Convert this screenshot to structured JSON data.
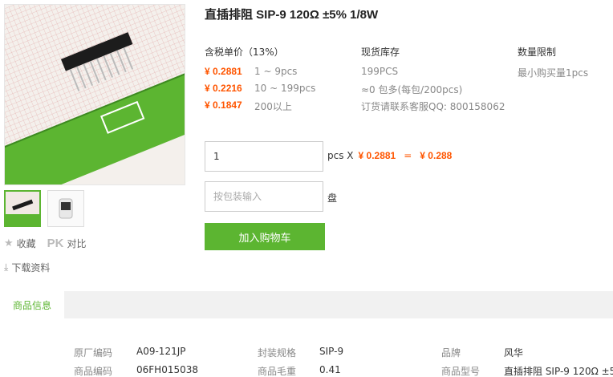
{
  "product": {
    "title": "直插排阻 SIP-9 120Ω ±5% 1/8W"
  },
  "pricing": {
    "header": "含税单价（13%）",
    "tiers": [
      {
        "price": "¥ 0.2881",
        "qty": "1 ~ 9pcs"
      },
      {
        "price": "¥ 0.2216",
        "qty": "10 ~ 199pcs"
      },
      {
        "price": "¥ 0.1847",
        "qty": "200以上"
      }
    ]
  },
  "stock": {
    "header": "现货库存",
    "lines": [
      "199PCS",
      "≈0 包多(每包/200pcs)",
      "订货请联系客服QQ: 800158062"
    ]
  },
  "limit": {
    "header": "数量限制",
    "text": "最小购买量1pcs"
  },
  "order": {
    "qty_value": "1",
    "unit_label": "pcs X",
    "unit_price": "¥ 0.2881",
    "equals": "=",
    "total": "¥ 0.288",
    "pkg_placeholder": "按包装输入",
    "pkg_unit": "盘",
    "cart_button": "加入购物车"
  },
  "actions": {
    "favorite": "收藏",
    "pk": "PK",
    "compare": "对比",
    "download": "下载资料"
  },
  "tabs": {
    "active": "商品信息"
  },
  "specs": [
    {
      "key": "原厂编码",
      "value": "A09-121JP"
    },
    {
      "key": "封装规格",
      "value": "SIP-9"
    },
    {
      "key": "品牌",
      "value": "风华"
    },
    {
      "key": "商品编码",
      "value": "06FH015038"
    },
    {
      "key": "商品毛重",
      "value": "0.41"
    },
    {
      "key": "商品型号",
      "value": "直插排阻 SIP-9 120Ω ±5..."
    }
  ],
  "colors": {
    "accent": "#5cb531",
    "price": "#ff5500"
  }
}
